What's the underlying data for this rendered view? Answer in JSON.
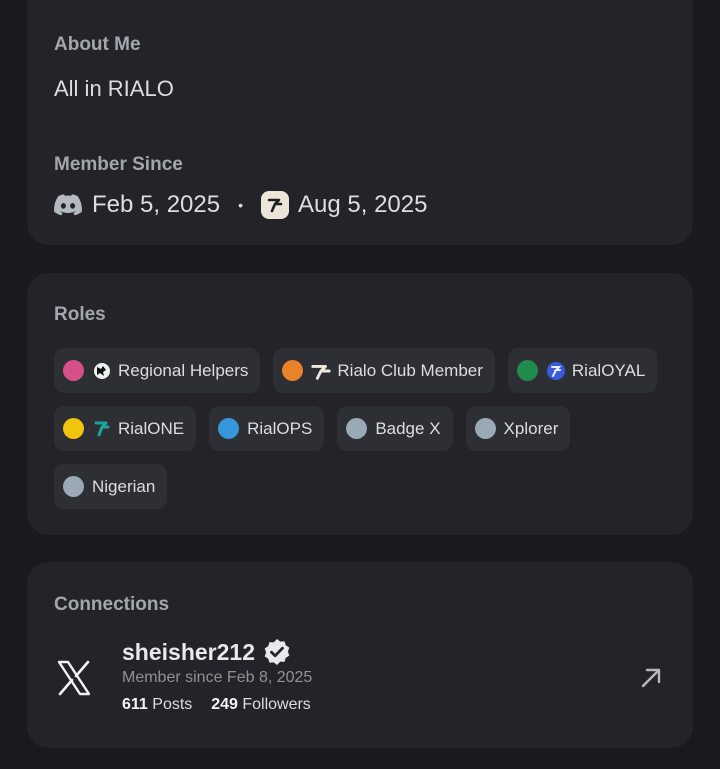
{
  "about": {
    "heading": "About Me",
    "text": "All in RIALO",
    "member_since_heading": "Member Since",
    "discord_since": "Feb 5, 2025",
    "separator": "•",
    "server_since": "Aug 5, 2025"
  },
  "roles": {
    "heading": "Roles",
    "items": [
      {
        "label": "Regional Helpers",
        "color": "#d6508a",
        "icon": "regional-helpers-icon"
      },
      {
        "label": "Rialo Club Member",
        "color": "#e8832a",
        "icon": "rialo-club-icon"
      },
      {
        "label": "RialOYAL",
        "color": "#1f8b4c",
        "icon": "rialoyal-icon"
      },
      {
        "label": "RialONE",
        "color": "#f1c40f",
        "icon": "rialone-icon"
      },
      {
        "label": "RialOPS",
        "color": "#3498db",
        "icon": ""
      },
      {
        "label": "Badge X",
        "color": "#99aab5",
        "icon": ""
      },
      {
        "label": "Xplorer",
        "color": "#99aab5",
        "icon": ""
      },
      {
        "label": "Nigerian",
        "color": "#99aab5",
        "icon": ""
      }
    ]
  },
  "connections": {
    "heading": "Connections",
    "account": {
      "service_icon": "x-logo-icon",
      "username": "sheisher212",
      "member_since": "Member since Feb 8, 2025",
      "posts_count": "611",
      "posts_label": "Posts",
      "followers_count": "249",
      "followers_label": "Followers"
    }
  }
}
